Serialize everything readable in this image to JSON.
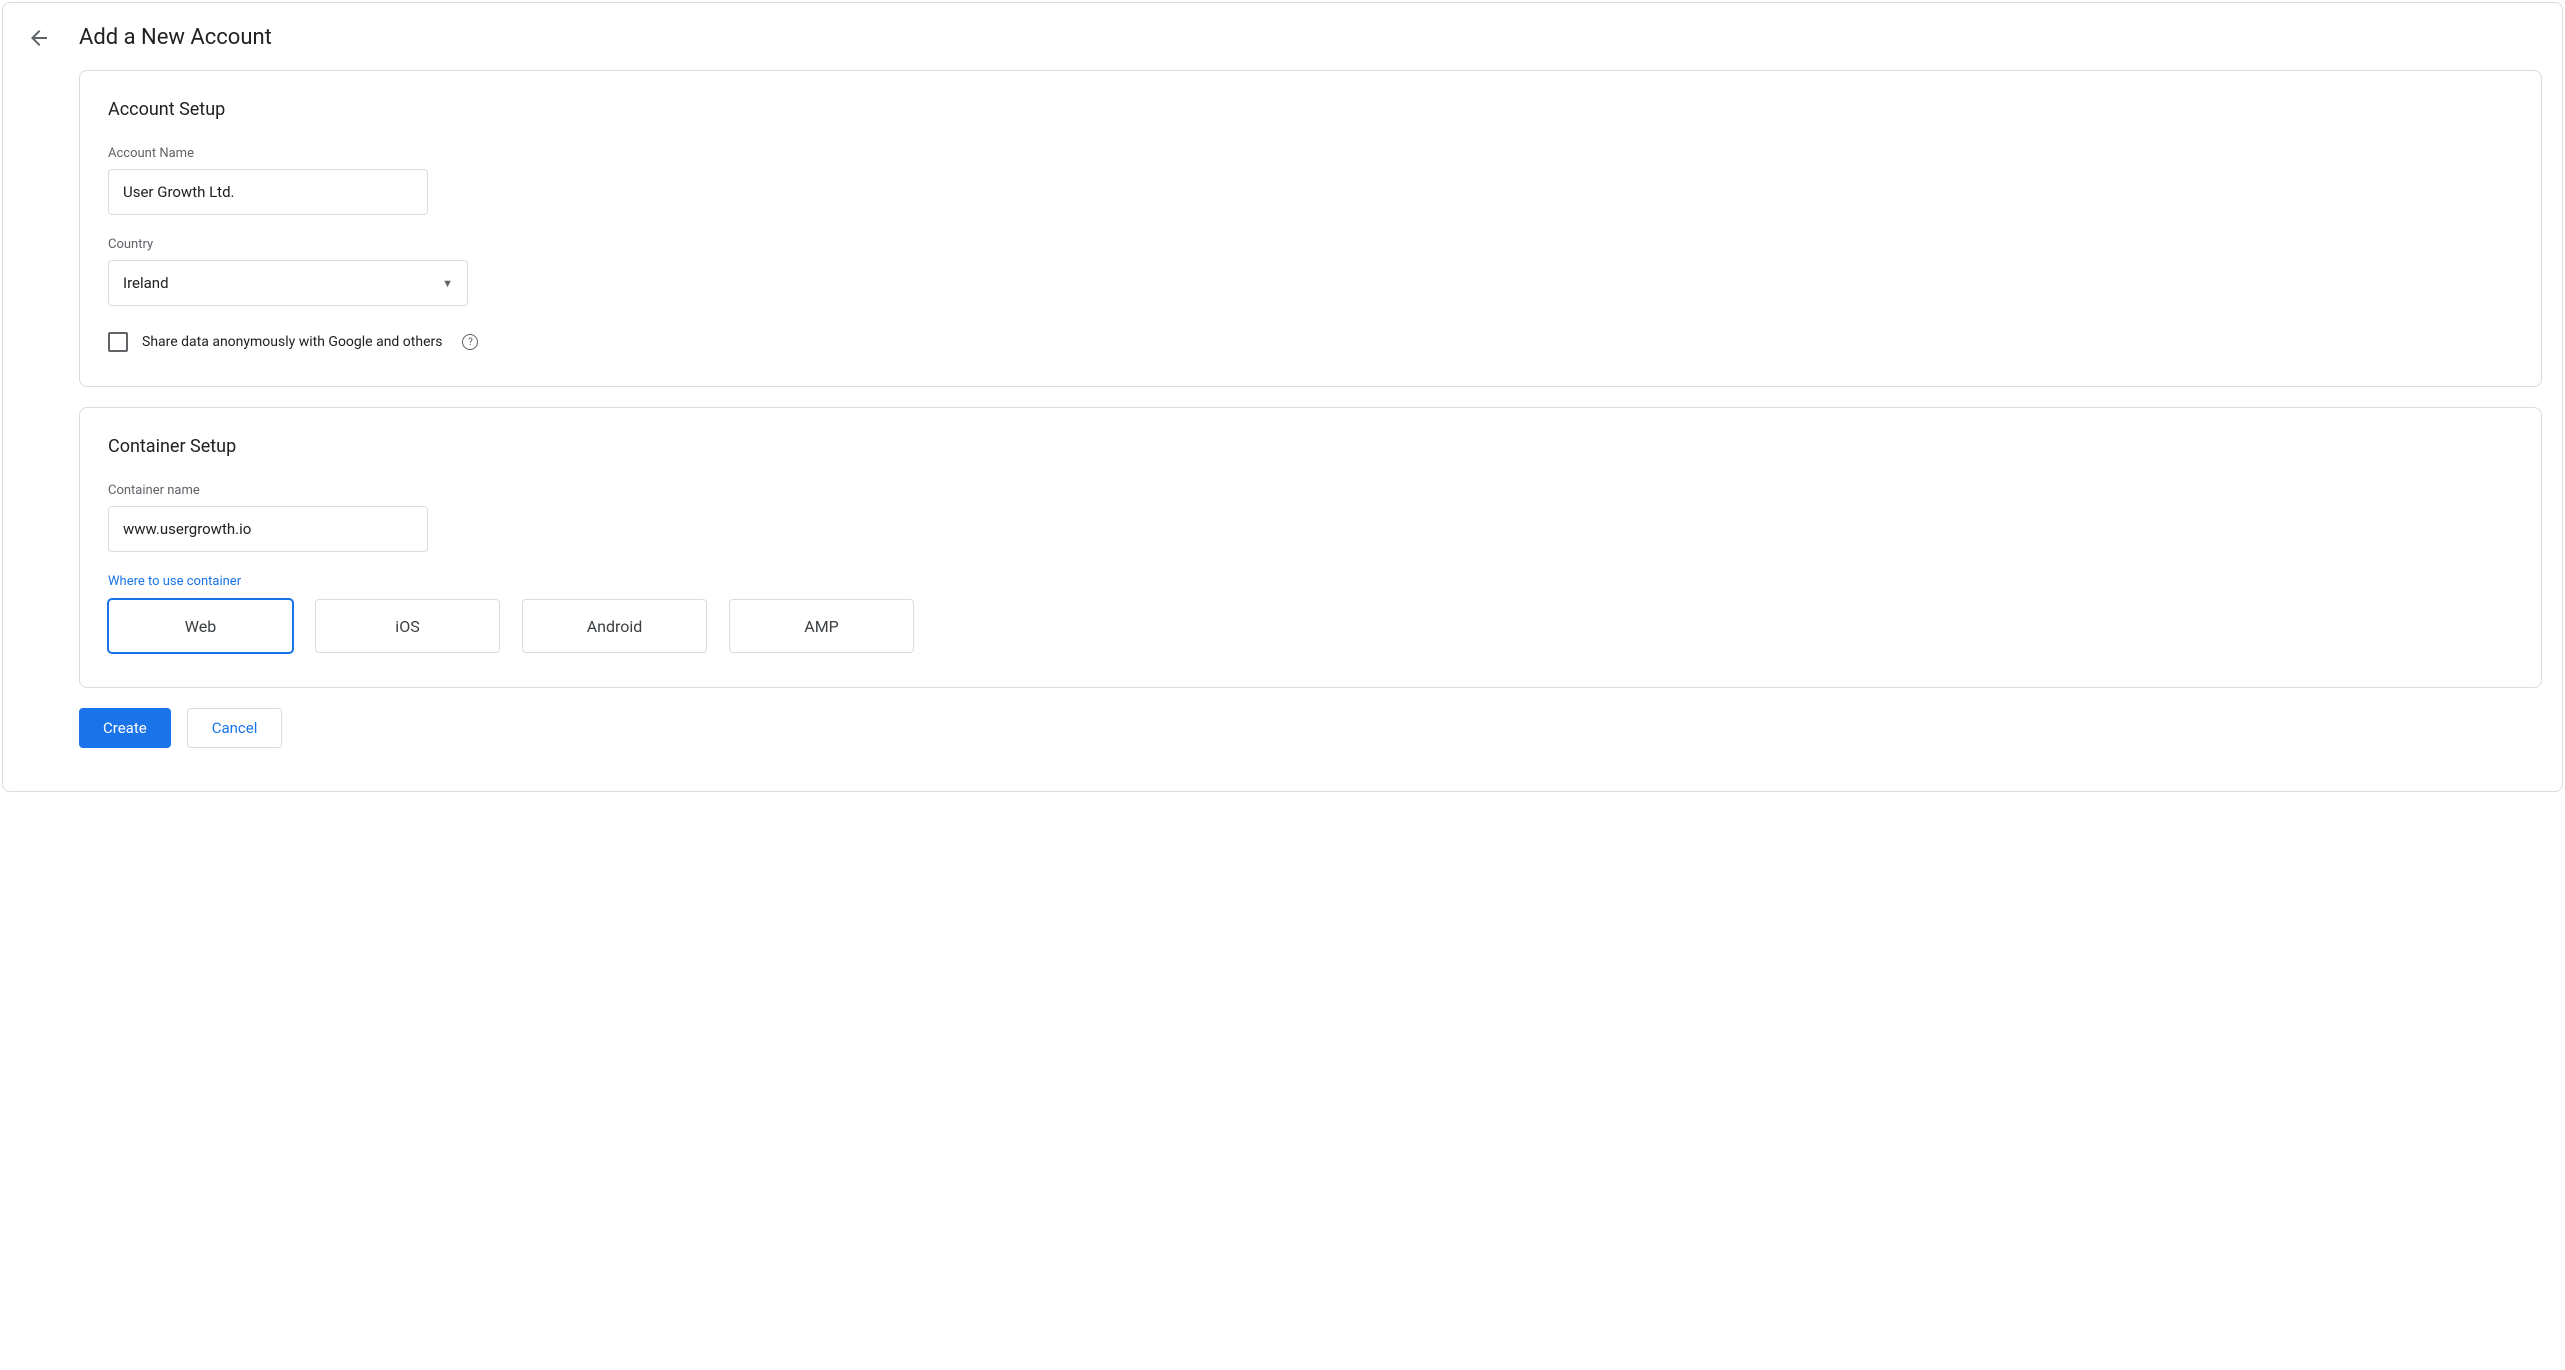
{
  "header": {
    "title": "Add a New Account"
  },
  "accountSetup": {
    "sectionTitle": "Account Setup",
    "accountNameLabel": "Account Name",
    "accountNameValue": "User Growth Ltd.",
    "countryLabel": "Country",
    "countryValue": "Ireland",
    "shareDataLabel": "Share data anonymously with Google and others"
  },
  "containerSetup": {
    "sectionTitle": "Container Setup",
    "containerNameLabel": "Container name",
    "containerNameValue": "www.usergrowth.io",
    "whereLabel": "Where to use container",
    "platforms": {
      "web": "Web",
      "ios": "iOS",
      "android": "Android",
      "amp": "AMP"
    }
  },
  "buttons": {
    "create": "Create",
    "cancel": "Cancel"
  }
}
